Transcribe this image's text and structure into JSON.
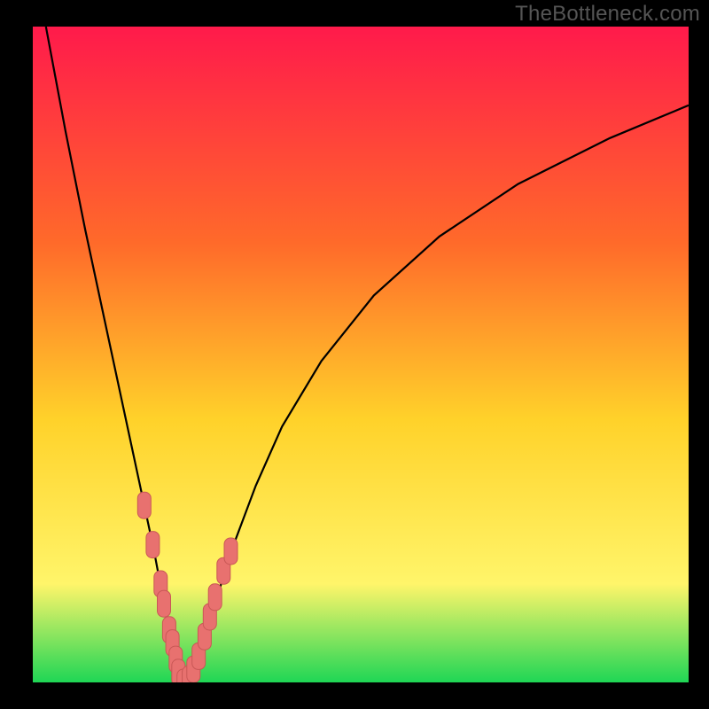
{
  "watermark": "TheBottleneck.com",
  "colors": {
    "gradient_top": "#ff1a4b",
    "gradient_mid1": "#ff6a2a",
    "gradient_mid2": "#ffd22a",
    "gradient_mid3": "#fff56a",
    "gradient_bottom": "#1fd655",
    "curve": "#000000",
    "marker_fill": "#e8716f",
    "marker_stroke": "#c95856",
    "frame": "#000000"
  },
  "chart_data": {
    "type": "line",
    "title": "",
    "xlabel": "",
    "ylabel": "",
    "xlim": [
      0,
      100
    ],
    "ylim": [
      0,
      100
    ],
    "series": [
      {
        "name": "bottleneck-curve",
        "x": [
          2,
          5,
          8,
          11,
          14,
          17,
          18.5,
          20,
          20.8,
          21.6,
          22.4,
          23.2,
          24,
          24.8,
          25.6,
          27,
          29,
          31,
          34,
          38,
          44,
          52,
          62,
          74,
          88,
          100
        ],
        "y": [
          100,
          84,
          69,
          55,
          41,
          27,
          20,
          12,
          8,
          4,
          1,
          0,
          0,
          1,
          4,
          9,
          16,
          22,
          30,
          39,
          49,
          59,
          68,
          76,
          83,
          88
        ]
      }
    ],
    "markers": {
      "name": "highlighted-points",
      "x": [
        17.0,
        18.3,
        19.5,
        20.0,
        20.8,
        21.3,
        21.8,
        22.2,
        23.0,
        23.8,
        24.5,
        25.3,
        26.2,
        27.0,
        27.8,
        29.1,
        30.2
      ],
      "y": [
        27,
        21,
        15,
        12,
        8,
        6,
        3.5,
        1.5,
        0,
        0.5,
        2,
        4,
        7,
        10,
        13,
        17,
        20
      ]
    }
  }
}
